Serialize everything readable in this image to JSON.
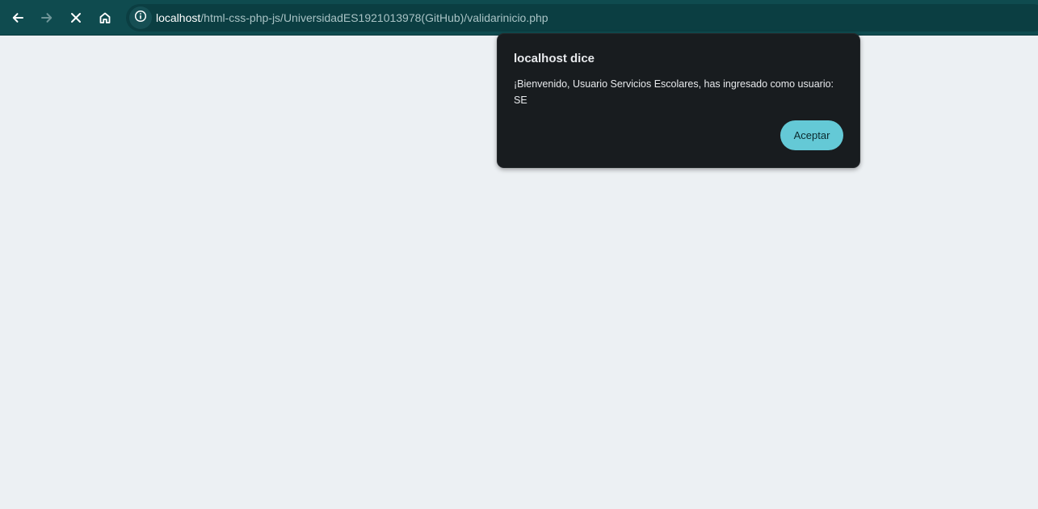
{
  "browser": {
    "nav": {
      "back_icon": "arrow-left-icon",
      "forward_icon": "arrow-right-icon",
      "stop_icon": "close-icon",
      "home_icon": "home-icon"
    },
    "address_bar": {
      "site_info_icon": "info-icon",
      "host": "localhost",
      "path": "/html-css-php-js/UniversidadES1921013978(GitHub)/validarinicio.php"
    }
  },
  "alert_dialog": {
    "title": "localhost dice",
    "message": "¡Bienvenido, Usuario Servicios Escolares, has ingresado como usuario: SE",
    "accept_label": "Aceptar"
  },
  "colors": {
    "toolbar": "#0f4b4f",
    "page_background": "#ecf0f3",
    "dialog_background": "#181c1f",
    "accept_button": "#64c9d6"
  }
}
